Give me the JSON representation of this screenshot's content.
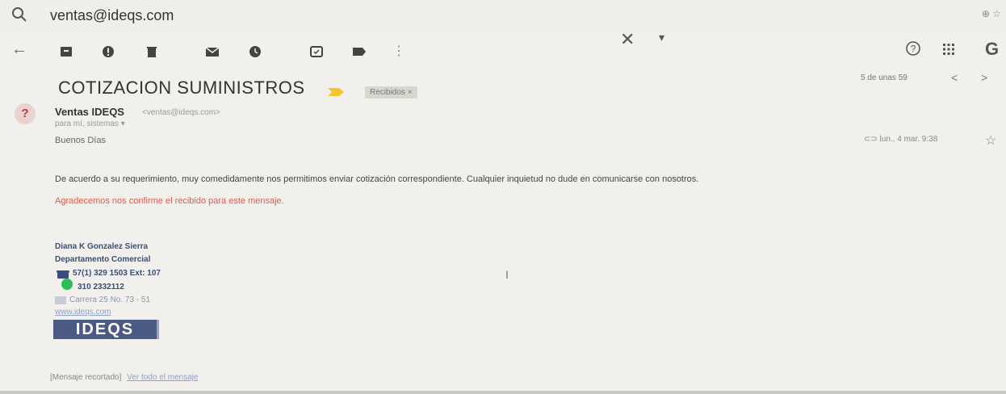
{
  "search": {
    "query": "ventas@ideqs.com"
  },
  "toolbar": {
    "back": "←",
    "clear": "✕",
    "dropdown": "▾",
    "more": "⋮",
    "google": "G"
  },
  "message": {
    "subject": "COTIZACION SUMINISTROS",
    "label": "Recibidos ×",
    "pager_text": "5 de unas 59",
    "pager_prev": "<",
    "pager_next": ">",
    "avatar": "?",
    "sender_name": "Ventas IDEQS",
    "sender_email": "<ventas@ideqs.com>",
    "recipients": "para mí, sistemas ▾",
    "date": "lun., 4 mar. 9:38",
    "greeting": "Buenos Días",
    "body": "De acuerdo a su requerimiento, muy comedidamente nos permitimos enviar cotización correspondiente. Cualquier inquietud no dude en comunicarse con nosotros.",
    "body_red": "Agradecemos nos confirme el recibido para este mensaje.",
    "signature": {
      "name": "Diana K Gonzalez Sierra",
      "department": "Departamento  Comercial",
      "phone": "57(1) 329 1503 Ext: 107",
      "mobile": "310 2332112",
      "address": "Carrera 25 No. 73 - 51",
      "website": "www.ideqs.com",
      "logo": "IDEQS"
    },
    "truncated_text": "[Mensaje recortado]",
    "view_full_link": "Ver todo el mensaje"
  },
  "colors": {
    "accent_red": "#e05a4a",
    "signature_blue": "#3b4d7a",
    "important_yellow": "#f4c430"
  }
}
